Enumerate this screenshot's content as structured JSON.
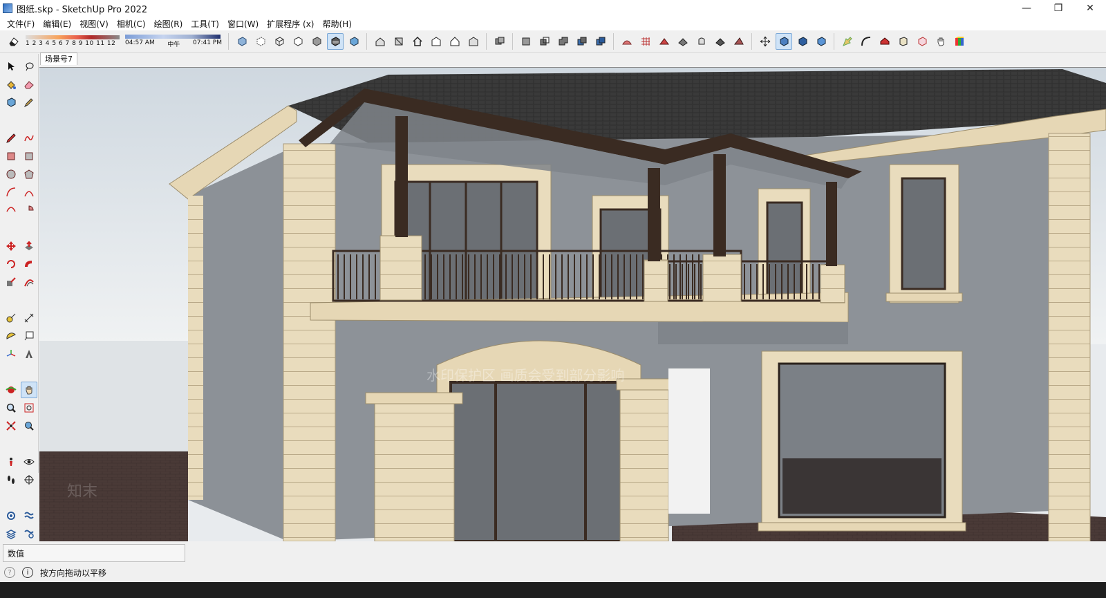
{
  "window": {
    "title": "图纸.skp - SketchUp Pro 2022",
    "minimize_glyph": "—",
    "restore_glyph": "❐",
    "close_glyph": "✕"
  },
  "menu": [
    {
      "label": "文件(F)"
    },
    {
      "label": "编辑(E)"
    },
    {
      "label": "视图(V)"
    },
    {
      "label": "相机(C)"
    },
    {
      "label": "绘图(R)"
    },
    {
      "label": "工具(T)"
    },
    {
      "label": "窗口(W)"
    },
    {
      "label": "扩展程序 (x)"
    },
    {
      "label": "帮助(H)"
    }
  ],
  "shadow": {
    "months_label": "1 2 3 4 5 6 7 8 9 10 11 12",
    "time_start": "04:57 AM",
    "time_mid": "中午",
    "time_end": "07:41 PM"
  },
  "scenes": [
    {
      "label": "场景号7"
    }
  ],
  "viewport": {
    "watermark_text": "水印保护区 画质会受到部分影响",
    "watermark_logo": "知末"
  },
  "vcb": {
    "label": "数值"
  },
  "status": {
    "info_glyph": "i",
    "geo_glyph": "?",
    "hint": "按方向拖动以平移"
  },
  "colors": {
    "sky": "#e8ebee",
    "roof": "#3b3b3b",
    "stucco": "#8d9298",
    "trim": "#e8d9b8",
    "metal": "#3a2b22",
    "ground": "#4a3a37",
    "active_tool": "#cfe3f7"
  }
}
